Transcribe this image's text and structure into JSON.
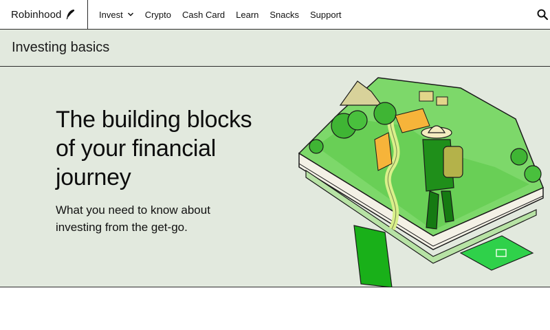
{
  "brand": {
    "name": "Robinhood",
    "icon": "feather-icon"
  },
  "nav": {
    "items": [
      {
        "label": "Invest",
        "has_dropdown": true
      },
      {
        "label": "Crypto"
      },
      {
        "label": "Cash Card"
      },
      {
        "label": "Learn"
      },
      {
        "label": "Snacks"
      },
      {
        "label": "Support"
      }
    ],
    "search_icon": "search-icon"
  },
  "hero": {
    "section_title": "Investing basics",
    "heading": "The building blocks of your financial journey",
    "description": "What you need to know about investing from the get-go.",
    "background_color": "#e2e9de",
    "illustration": "explorer-on-book-landscape"
  },
  "colors": {
    "accent": "#00c805",
    "border": "#2b2b2b"
  }
}
